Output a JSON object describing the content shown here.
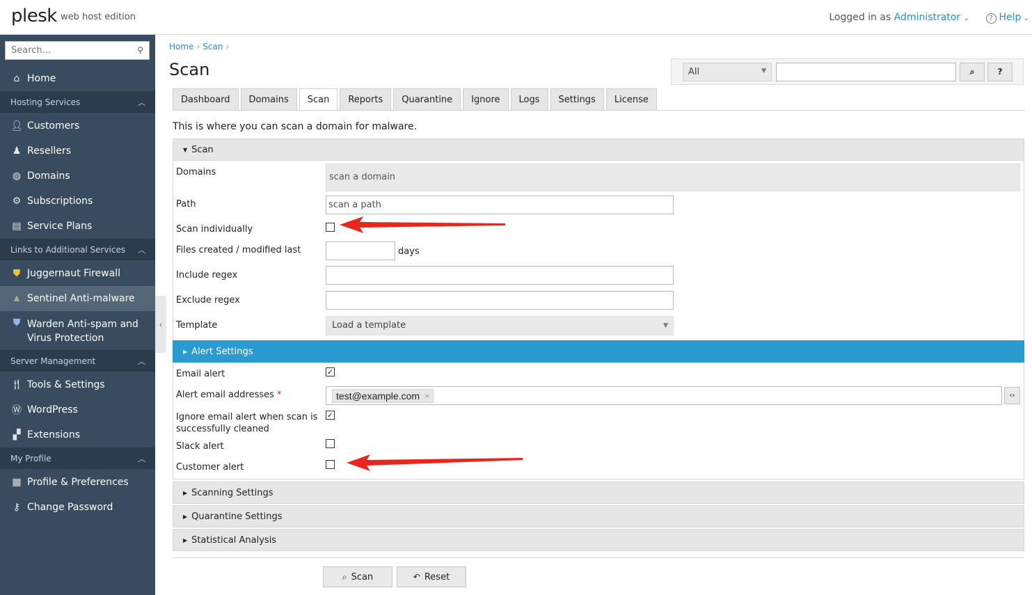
{
  "header": {
    "logo": "plesk",
    "logo_sub": "web host edition",
    "logged_in_prefix": "Logged in as",
    "user": "Administrator",
    "help": "Help"
  },
  "sidebar": {
    "search_placeholder": "Search...",
    "home": "Home",
    "sections": {
      "hosting": "Hosting Services",
      "links": "Links to Additional Services",
      "server": "Server Management",
      "profile": "My Profile"
    },
    "items": {
      "customers": "Customers",
      "resellers": "Resellers",
      "domains": "Domains",
      "subscriptions": "Subscriptions",
      "service_plans": "Service Plans",
      "juggernaut": "Juggernaut Firewall",
      "sentinel": "Sentinel Anti-malware",
      "warden_1": "Warden Anti-spam and",
      "warden_2": "Virus Protection",
      "tools": "Tools & Settings",
      "wordpress": "WordPress",
      "extensions": "Extensions",
      "profile_prefs": "Profile & Preferences",
      "change_password": "Change Password"
    }
  },
  "breadcrumb": {
    "home": "Home",
    "scan": "Scan"
  },
  "page_title": "Scan",
  "filter": {
    "select_value": "All",
    "search_btn": "⌕",
    "help_btn": "?"
  },
  "tabs": [
    "Dashboard",
    "Domains",
    "Scan",
    "Reports",
    "Quarantine",
    "Ignore",
    "Logs",
    "Settings",
    "License"
  ],
  "active_tab": "Scan",
  "intro": "This is where you can scan a domain for malware.",
  "scan_section": {
    "title": "Scan",
    "domains_label": "Domains",
    "domains_placeholder": "scan a domain",
    "path_label": "Path",
    "path_placeholder": "scan a path",
    "scan_individually_label": "Scan individually",
    "scan_individually_checked": false,
    "files_label": "Files created / modified last",
    "files_unit": "days",
    "include_label": "Include regex",
    "exclude_label": "Exclude regex",
    "template_label": "Template",
    "template_value": "Load a template"
  },
  "alert_section": {
    "title": "Alert Settings",
    "email_alert_label": "Email alert",
    "email_alert_checked": true,
    "addresses_label": "Alert email addresses",
    "required_mark": "*",
    "address_tag": "test@example.com",
    "ignore_label_1": "Ignore email alert when scan is",
    "ignore_label_2": "successfully cleaned",
    "ignore_checked": true,
    "slack_label": "Slack alert",
    "slack_checked": false,
    "customer_label": "Customer alert",
    "customer_checked": false
  },
  "collapsed_sections": [
    "Scanning Settings",
    "Quarantine Settings",
    "Statistical Analysis"
  ],
  "buttons": {
    "scan": "Scan",
    "reset": "Reset"
  },
  "colors": {
    "sidebar": "#394b5f",
    "accent": "#2a9bd0",
    "link": "#2b8fc9",
    "annotation_arrow": "#e8261c"
  }
}
